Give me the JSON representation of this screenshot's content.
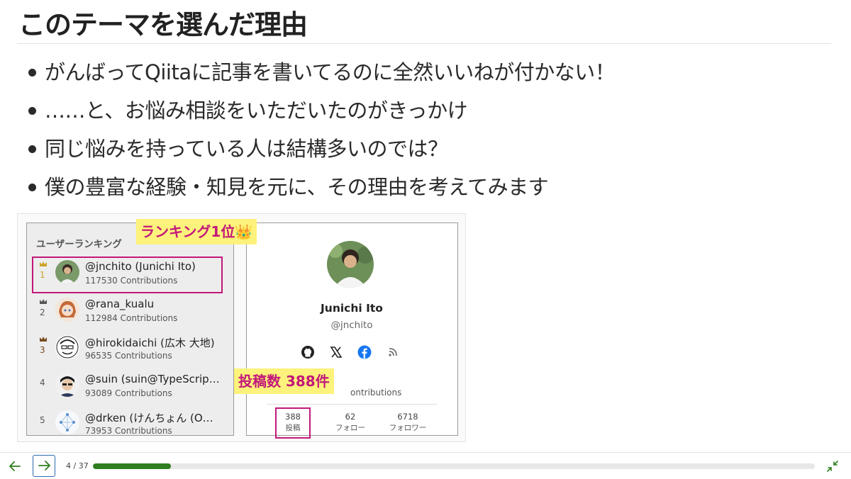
{
  "slide": {
    "title": "このテーマを選んだ理由",
    "bullets": [
      "がんばってQiitaに記事を書いてるのに全然いいねが付かない！",
      "……と、お悩み相談をいただいたのがきっかけ",
      "同じ悩みを持っている人は結構多いのでは？",
      "僕の豊富な経験・知見を元に、その理由を考えてみます"
    ]
  },
  "ranking": {
    "title": "ユーザーランキング",
    "rows": [
      {
        "rank": "1",
        "user": "@jnchito (Junichi Ito)",
        "contrib": "117530 Contributions",
        "crown": "gold-crown-icon"
      },
      {
        "rank": "2",
        "user": "@rana_kualu",
        "contrib": "112984 Contributions",
        "crown": "silver-crown-icon"
      },
      {
        "rank": "3",
        "user": "@hirokidaichi (広木 大地)",
        "contrib": "96535 Contributions",
        "crown": "bronze-crown-icon"
      },
      {
        "rank": "4",
        "user": "@suin (suin@TypeScrip…",
        "contrib": "93089 Contributions"
      },
      {
        "rank": "5",
        "user": "@drken (けんちょん (O…",
        "contrib": "73953 Contributions"
      }
    ]
  },
  "profile": {
    "name": "Junichi Ito",
    "handle": "@jnchito",
    "icons": [
      "github-icon",
      "x-icon",
      "facebook-icon",
      "rss-icon"
    ],
    "contrib_fragment": "ontributions",
    "stats": [
      {
        "value": "388",
        "label": "投稿"
      },
      {
        "value": "62",
        "label": "フォロー"
      },
      {
        "value": "6718",
        "label": "フォロワー"
      }
    ]
  },
  "callouts": {
    "rank": "ランキング1位👑",
    "posts": "投稿数 388件"
  },
  "footer": {
    "page": "4 / 37",
    "progress": 0.108
  },
  "colors": {
    "highlight_border": "#c2187a",
    "callout_bg": "#fdf27b",
    "progress": "#2e7d1e",
    "nav_accent": "#2b6cb0"
  }
}
